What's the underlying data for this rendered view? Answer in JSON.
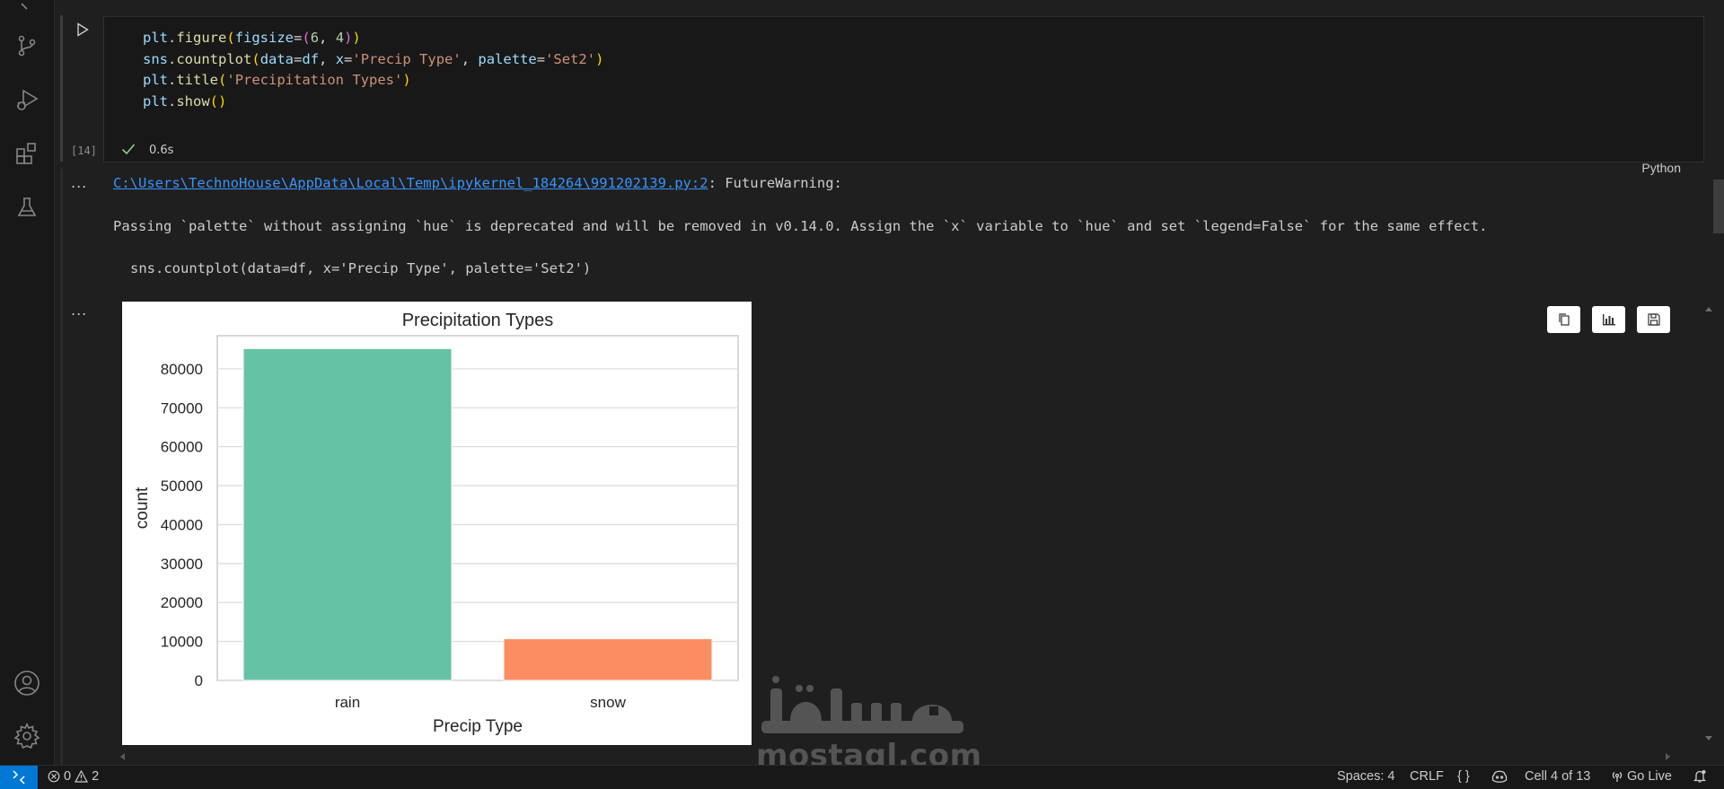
{
  "cell": {
    "code_lines": [
      "plt.figure(figsize=(6, 4))",
      "sns.countplot(data=df, x='Precip Type', palette='Set2')",
      "plt.title('Precipitation Types')",
      "plt.show()"
    ],
    "exec_count": "[14]",
    "exec_time": "0.6s",
    "language": "Python"
  },
  "output": {
    "ellipsis": "...",
    "warning_path": "C:\\Users\\TechnoHouse\\AppData\\Local\\Temp\\ipykernel_184264\\991202139.py:2",
    "warning_suffix": ": FutureWarning:",
    "warning_message": "Passing `palette` without assigning `hue` is deprecated and will be removed in v0.14.0. Assign the `x` variable to `hue` and set `legend=False` for the same effect.",
    "warning_code": "sns.countplot(data=df, x='Precip Type', palette='Set2')"
  },
  "chart_data": {
    "type": "bar",
    "title": "Precipitation Types",
    "xlabel": "Precip Type",
    "ylabel": "count",
    "categories": [
      "rain",
      "snow"
    ],
    "values": [
      85200,
      10700
    ],
    "ylim": [
      0,
      88500
    ],
    "yticks": [
      0,
      10000,
      20000,
      30000,
      40000,
      50000,
      60000,
      70000,
      80000
    ],
    "grid": true,
    "colors": [
      "#66c2a5",
      "#fc8d62"
    ]
  },
  "plot_toolbar": [
    "copy-icon",
    "chart-icon",
    "save-icon"
  ],
  "watermark": {
    "arabic": "مستقل",
    "latin": "mostaql.com"
  },
  "status_bar": {
    "errors": "0",
    "warnings": "2",
    "spaces": "Spaces: 4",
    "eol": "CRLF",
    "braces": "{ }",
    "cell_pos": "Cell 4 of 13",
    "go_live": "Go Live"
  },
  "colors": {
    "accent": "#0078d4",
    "link": "#3794ff"
  }
}
